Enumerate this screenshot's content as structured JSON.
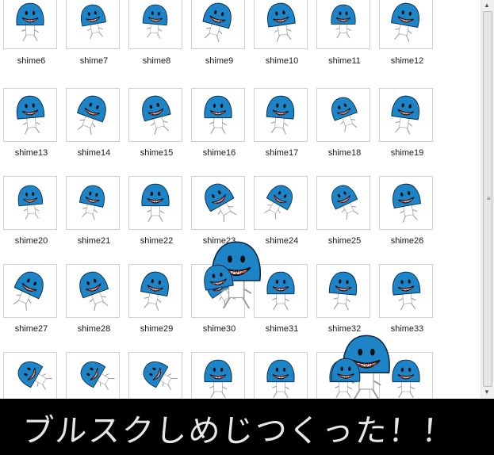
{
  "files": [
    {
      "name": "shime6"
    },
    {
      "name": "shime7"
    },
    {
      "name": "shime8"
    },
    {
      "name": "shime9"
    },
    {
      "name": "shime10"
    },
    {
      "name": "shime11"
    },
    {
      "name": "shime12"
    },
    {
      "name": "shime13"
    },
    {
      "name": "shime14"
    },
    {
      "name": "shime15"
    },
    {
      "name": "shime16"
    },
    {
      "name": "shime17"
    },
    {
      "name": "shime18"
    },
    {
      "name": "shime19"
    },
    {
      "name": "shime20"
    },
    {
      "name": "shime21"
    },
    {
      "name": "shime22"
    },
    {
      "name": "shime23"
    },
    {
      "name": "shime24"
    },
    {
      "name": "shime25"
    },
    {
      "name": "shime26"
    },
    {
      "name": "shime27"
    },
    {
      "name": "shime28"
    },
    {
      "name": "shime29"
    },
    {
      "name": "shime30"
    },
    {
      "name": "shime31"
    },
    {
      "name": "shime32"
    },
    {
      "name": "shime33"
    },
    {
      "name": ""
    },
    {
      "name": ""
    },
    {
      "name": ""
    },
    {
      "name": ""
    },
    {
      "name": ""
    },
    {
      "name": ""
    },
    {
      "name": ""
    }
  ],
  "colors": {
    "mascot_blue": "#1d84c8",
    "mascot_outline": "#0a2a44",
    "window_bg": "#ffffff",
    "overlay_bg": "#000000"
  },
  "overlay_caption": "ブルスクしめじつくった！！",
  "icons": {
    "scroll_up": "scroll-up-arrow-icon",
    "scroll_down": "scroll-down-arrow-icon",
    "mascot": "shimeji-mascot-icon"
  }
}
